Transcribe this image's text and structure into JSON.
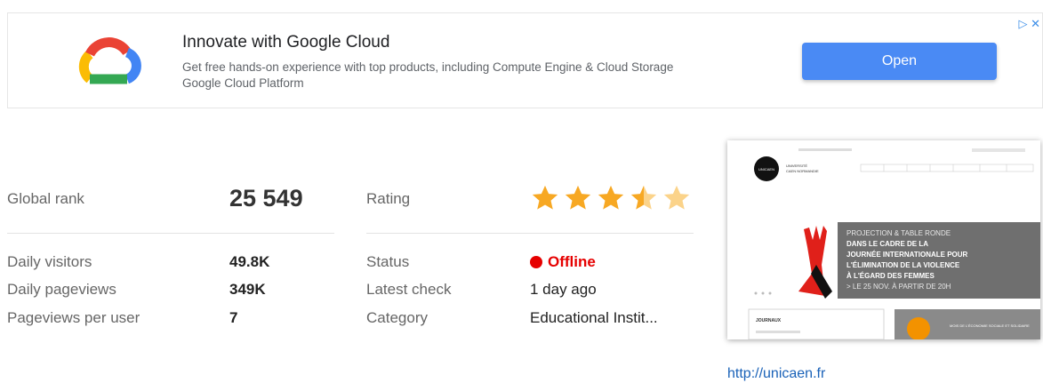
{
  "ad": {
    "title": "Innovate with Google Cloud",
    "description": "Get free hands-on experience with top products, including Compute Engine & Cloud Storage",
    "advertiser": "Google Cloud Platform",
    "open_label": "Open",
    "adchoices": "▷ ✕"
  },
  "stats": {
    "global_rank_label": "Global rank",
    "global_rank_value": "25 549",
    "daily_visitors_label": "Daily visitors",
    "daily_visitors_value": "49.8K",
    "daily_pageviews_label": "Daily pageviews",
    "daily_pageviews_value": "349K",
    "pageviews_per_user_label": "Pageviews per user",
    "pageviews_per_user_value": "7",
    "rating_label": "Rating",
    "rating_value": 3.5,
    "rating_max": 5,
    "status_label": "Status",
    "status_value": "Offline",
    "latest_check_label": "Latest check",
    "latest_check_value": "1 day ago",
    "category_label": "Category",
    "category_value": "Educational Instit..."
  },
  "thumbnail": {
    "logo_text": "UNICAEN",
    "university_name_line1": "UNIVERSITÉ",
    "university_name_line2": "CAEN NORMANDIE",
    "banner_line1": "PROJECTION & TABLE RONDE",
    "banner_line2": "DANS LE CADRE DE LA",
    "banner_line3": "JOURNÉE INTERNATIONALE POUR",
    "banner_line4": "L'ÉLIMINATION DE LA VIOLENCE",
    "banner_line5": "À L'ÉGARD DES FEMMES",
    "banner_line6": "> LE 25 NOV. À PARTIR DE 20H",
    "card_label": "JOURNAUX",
    "card2_label": "MOIS DE L'ÉCONOMIE SOCIALE ET SOLIDAIRE"
  },
  "site_url": "http://unicaen.fr",
  "colors": {
    "accent": "#4a8af4",
    "star": "#f7a823",
    "offline": "#e60000",
    "link": "#1a62b8"
  }
}
